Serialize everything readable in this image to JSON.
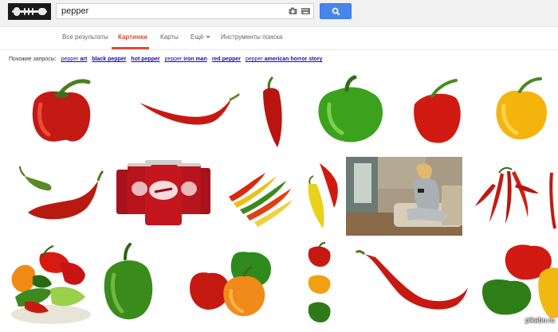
{
  "search": {
    "query": "pepper",
    "camera_icon": "camera-icon",
    "keyboard_icon": "keyboard-icon",
    "button_icon": "magnifier-icon",
    "accent": "#4a86e8"
  },
  "tabs": {
    "all": "Все результаты",
    "images": "Картинки",
    "maps": "Карты",
    "more": "Ещё",
    "tools": "Инструменты поиска",
    "active_color": "#dd4b39"
  },
  "related": {
    "label": "Похожие запросы:",
    "items": [
      {
        "plain": "pepper ",
        "bold": "art"
      },
      {
        "plain": "",
        "bold": "black pepper"
      },
      {
        "plain": "",
        "bold": "hot pepper"
      },
      {
        "plain": "pepper ",
        "bold": "iron man"
      },
      {
        "plain": "",
        "bold": "red pepper"
      },
      {
        "plain": "pepper ",
        "bold": "american horror story"
      }
    ]
  },
  "watermark": "pikabu.ru"
}
